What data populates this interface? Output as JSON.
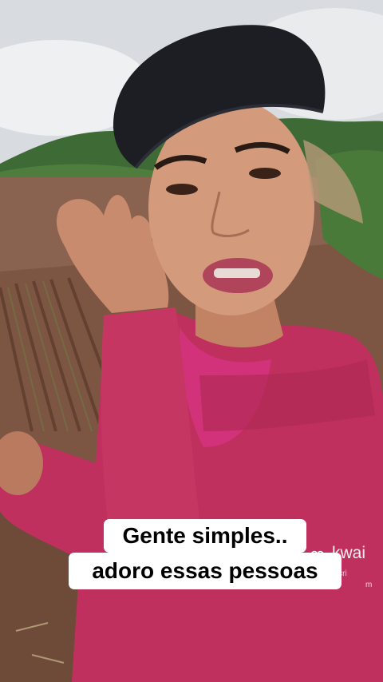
{
  "caption": {
    "line1": "Gente simples..",
    "line2": "adoro essas pessoas"
  },
  "watermark": {
    "brand": "kwai",
    "user_line1": "lvaalecri",
    "user_line2": "m",
    "icon": "kwai-logo-icon"
  },
  "colors": {
    "sky": "#d9dde0",
    "hill": "#3d6b34",
    "soil": "#7a5240",
    "shirt": "#c0305e",
    "cap": "#1a1c22"
  }
}
